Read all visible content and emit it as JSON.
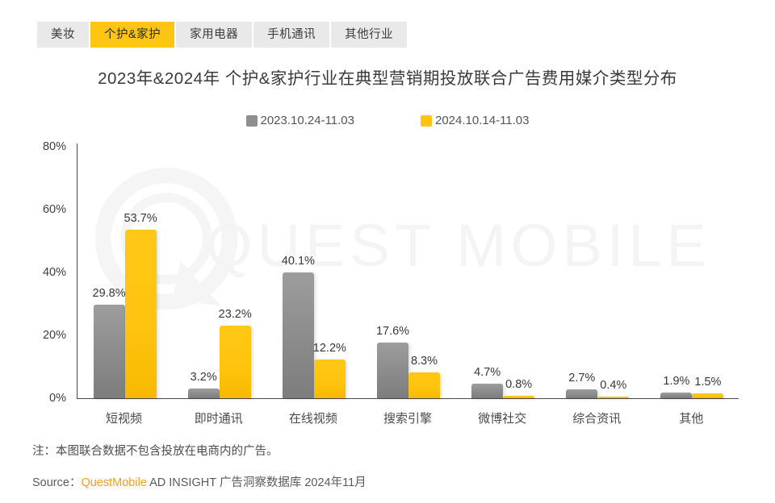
{
  "tabs": [
    {
      "label": "美妆",
      "active": false
    },
    {
      "label": "个护&家护",
      "active": true
    },
    {
      "label": "家用电器",
      "active": false
    },
    {
      "label": "手机通讯",
      "active": false
    },
    {
      "label": "其他行业",
      "active": false
    }
  ],
  "title": "2023年&2024年 个护&家护行业在典型营销期投放联合广告费用媒介类型分布",
  "watermark": {
    "text": "QUEST MOBILE",
    "mark": "quest-mobile-q-logo"
  },
  "footer": {
    "note": "注：本图联合数据不包含投放在电商内的广告。",
    "source_prefix": "Source：",
    "source_brand": "QuestMobile",
    "source_rest": " AD INSIGHT 广告洞察数据库 2024年11月"
  },
  "colors": {
    "series_2023": "#8e8e8e",
    "series_2024": "#ffc512",
    "tab_active_bg": "#ffc512",
    "tab_inactive_bg": "#e9e9e9",
    "brand_orange": "#f0a020",
    "axis": "#4a4a4a"
  },
  "chart_data": {
    "type": "bar",
    "title": "2023年&2024年 个护&家护行业在典型营销期投放联合广告费用媒介类型分布",
    "xlabel": "",
    "ylabel": "",
    "ylim": [
      0,
      80
    ],
    "ytick_labels": [
      "0%",
      "20%",
      "40%",
      "60%",
      "80%"
    ],
    "ytick_values": [
      0,
      20,
      40,
      60,
      80
    ],
    "grid": false,
    "legend_position": "top-center",
    "value_suffix": "%",
    "categories": [
      "短视频",
      "即时通讯",
      "在线视频",
      "搜索引擎",
      "微博社交",
      "综合资讯",
      "其他"
    ],
    "series": [
      {
        "name": "2023.10.24-11.03",
        "color": "#8e8e8e",
        "values": [
          29.8,
          3.2,
          40.1,
          17.6,
          4.7,
          2.7,
          1.9
        ],
        "labels": [
          "29.8%",
          "3.2%",
          "40.1%",
          "17.6%",
          "4.7%",
          "2.7%",
          "1.9%"
        ]
      },
      {
        "name": "2024.10.14-11.03",
        "color": "#ffc512",
        "values": [
          53.7,
          23.2,
          12.2,
          8.3,
          0.8,
          0.4,
          1.5
        ],
        "labels": [
          "53.7%",
          "23.2%",
          "12.2%",
          "8.3%",
          "0.8%",
          "0.4%",
          "1.5%"
        ]
      }
    ]
  }
}
